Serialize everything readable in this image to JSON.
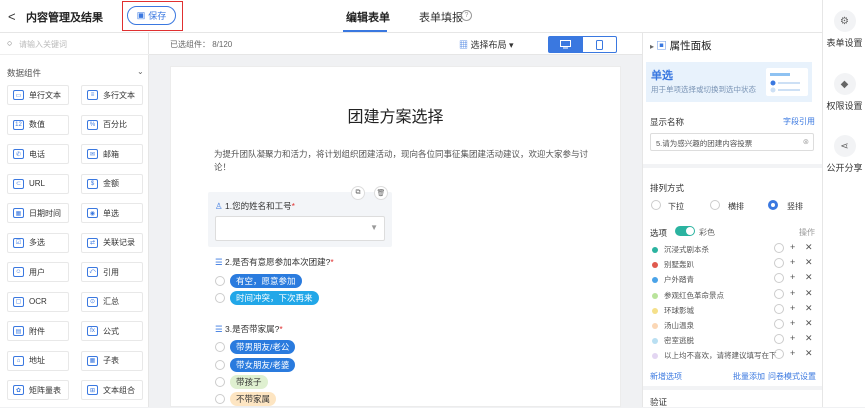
{
  "header": {
    "back": "<",
    "title": "内容管理及结果",
    "save": "保存",
    "tabs": [
      "编辑表单",
      "表单填报"
    ],
    "help": "?"
  },
  "rightbar": [
    {
      "label": "表单设置",
      "icon": "form-settings-icon"
    },
    {
      "label": "权限设置",
      "icon": "shield-icon"
    },
    {
      "label": "公开分享",
      "icon": "share-icon"
    }
  ],
  "left": {
    "search_placeholder": "请输入关键词",
    "group": "数据组件",
    "components": [
      [
        "单行文本",
        "多行文本"
      ],
      [
        "数值",
        "百分比"
      ],
      [
        "电话",
        "邮箱"
      ],
      [
        "URL",
        "金额"
      ],
      [
        "日期时间",
        "单选"
      ],
      [
        "多选",
        "关联记录"
      ],
      [
        "用户",
        "引用"
      ],
      [
        "OCR",
        "汇总"
      ],
      [
        "附件",
        "公式"
      ],
      [
        "地址",
        "子表"
      ],
      [
        "矩阵量表",
        "文本组合"
      ]
    ]
  },
  "canvas": {
    "selected": "已选组件： 8/120",
    "layout": "选择布局 ▾"
  },
  "form": {
    "title": "团建方案选择",
    "desc": "为提升团队凝聚力和活力，将计划组织团建活动，现向各位同事征集团建活动建议，欢迎大家参与讨论！",
    "q1": "1.您的姓名和工号",
    "q2": "2.是否有意愿参加本次团建?",
    "q2opts": [
      "有空，愿意参加",
      "时间冲突，下次再来"
    ],
    "q3": "3.是否带家属?",
    "q3opts": [
      "带男朋友/老公",
      "带女朋友/老婆",
      "带孩子",
      "不带家属"
    ],
    "req": "*",
    "colors": {
      "q2": [
        "#2a7bde",
        "#22a7e8"
      ],
      "q3": [
        "#2a7bde",
        "#2a7bde",
        "#dff0d0",
        "#fde5c2"
      ]
    }
  },
  "props": {
    "title": "属性面板",
    "type": "单选",
    "type_desc": "用于单项选择或切换到选中状态",
    "display_name_label": "显示名称",
    "field_ref": "字段引用",
    "display_value": "5.请为感兴趣的团建内容投票",
    "arrange": "排列方式",
    "arrange_opts": [
      "下拉",
      "横排",
      "竖排"
    ],
    "options_label": "选项",
    "color_label": "彩色",
    "ops": "操作",
    "options": [
      {
        "label": "沉浸式剧本杀",
        "color": "#2bb3a0"
      },
      {
        "label": "别墅轰趴",
        "color": "#e05a4e"
      },
      {
        "label": "户外踏青",
        "color": "#4aa3e8"
      },
      {
        "label": "参观红色革命景点",
        "color": "#b9e39b"
      },
      {
        "label": "环球影城",
        "color": "#f5e08a"
      },
      {
        "label": "汤山温泉",
        "color": "#fbd7b5"
      },
      {
        "label": "密室逃脱",
        "color": "#b9dff2"
      },
      {
        "label": "以上均不喜欢，请将建议填写在下",
        "color": "#e3d6f2"
      }
    ],
    "add_option": "新增选项",
    "batch_add": "批量添加",
    "questionnaire": "问卷模式设置",
    "validation": "验证"
  }
}
